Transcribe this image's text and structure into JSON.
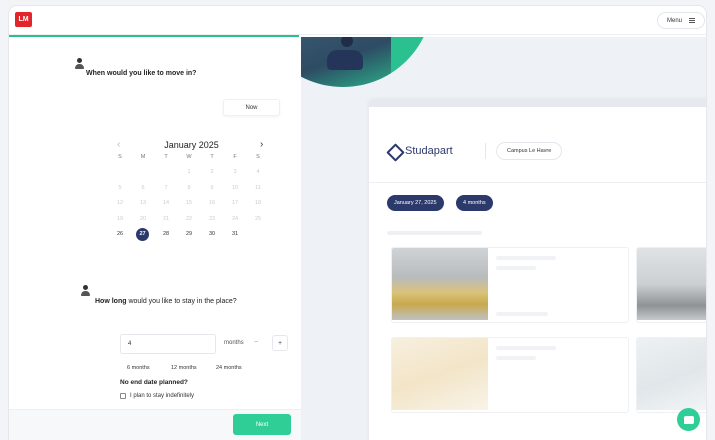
{
  "header": {
    "logo_text": "LM",
    "menu_label": "Menu"
  },
  "move_in": {
    "question": "When would you like to move in?",
    "now_label": "Now",
    "calendar": {
      "month_label": "January 2025",
      "weekdays": [
        "S",
        "M",
        "T",
        "W",
        "T",
        "F",
        "S"
      ],
      "weeks": [
        [
          "",
          "",
          "",
          "1",
          "2",
          "3",
          "4"
        ],
        [
          "5",
          "6",
          "7",
          "8",
          "9",
          "10",
          "11"
        ],
        [
          "12",
          "13",
          "14",
          "15",
          "16",
          "17",
          "18"
        ],
        [
          "19",
          "20",
          "21",
          "22",
          "23",
          "24",
          "25"
        ],
        [
          "26",
          "27",
          "28",
          "29",
          "30",
          "31",
          ""
        ]
      ],
      "selected_day": "27"
    }
  },
  "duration": {
    "question_bold": "How long",
    "question_rest": " would you like to stay in the place?",
    "value": "4",
    "unit": "months",
    "minus": "−",
    "plus": "+",
    "presets": [
      "6 months",
      "12 months",
      "24 months"
    ],
    "no_end_title": "No end date planned?",
    "indefinite_label": "I plan to stay indefinitely"
  },
  "footer": {
    "next_label": "Next"
  },
  "preview": {
    "brand": "Studapart",
    "campus": "Campus Le Havre",
    "date_pill": "January 27, 2025",
    "months_pill": "4 months"
  },
  "colors": {
    "accent_green": "#2fce96",
    "navy": "#2b3a6b",
    "brand_red": "#e1252b"
  }
}
